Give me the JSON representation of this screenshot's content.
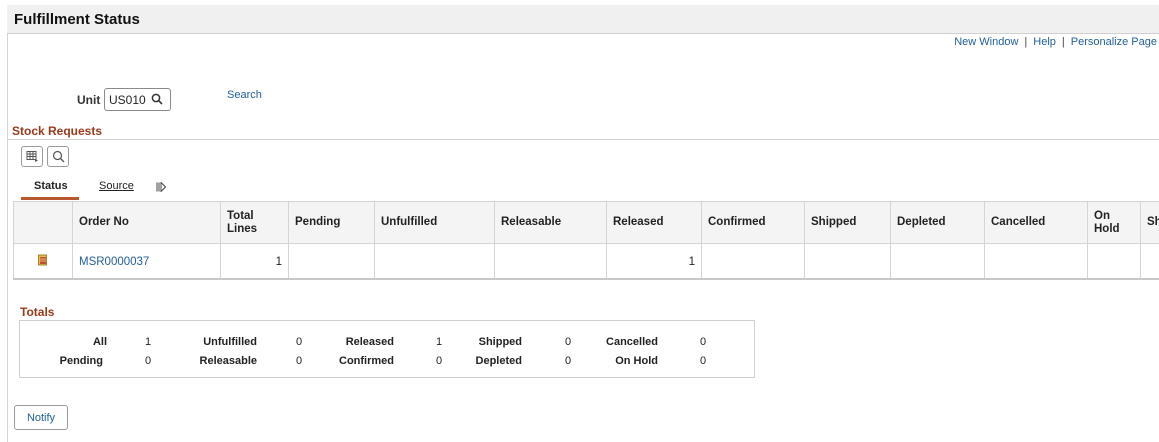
{
  "page": {
    "title": "Fulfillment Status"
  },
  "toplinks": {
    "new_window": "New Window",
    "help": "Help",
    "personalize": "Personalize Page",
    "separator": "|"
  },
  "search": {
    "unit_label": "Unit",
    "unit_value": "US010",
    "search_link": "Search"
  },
  "stock_requests": {
    "title": "Stock Requests",
    "tabs": [
      {
        "label": "Status"
      },
      {
        "label": "Source"
      }
    ],
    "columns": [
      "Order No",
      "Total Lines",
      "Pending",
      "Unfulfilled",
      "Releasable",
      "Released",
      "Confirmed",
      "Shipped",
      "Depleted",
      "Cancelled",
      "On Hold",
      "Sh"
    ],
    "rows": [
      {
        "order_no": "MSR0000037",
        "total_lines": "1",
        "pending": "",
        "unfulfilled": "",
        "releasable": "",
        "released": "1",
        "confirmed": "",
        "shipped": "",
        "depleted": "",
        "cancelled": "",
        "on_hold": ""
      }
    ]
  },
  "totals": {
    "title": "Totals",
    "row1": [
      {
        "label": "All",
        "value": "1"
      },
      {
        "label": "Unfulfilled",
        "value": "0"
      },
      {
        "label": "Released",
        "value": "1"
      },
      {
        "label": "Shipped",
        "value": "0"
      },
      {
        "label": "Cancelled",
        "value": "0"
      }
    ],
    "row2": [
      {
        "label": "Pending",
        "value": "0"
      },
      {
        "label": "Releasable",
        "value": "0"
      },
      {
        "label": "Confirmed",
        "value": "0"
      },
      {
        "label": "Depleted",
        "value": "0"
      },
      {
        "label": "On Hold",
        "value": "0"
      }
    ]
  },
  "buttons": {
    "notify": "Notify"
  },
  "colors": {
    "link": "#1f5f9a",
    "section_header": "#9a3a1a",
    "tab_accent": "#b8572b"
  },
  "icons": {
    "unit_lookup": "search-icon",
    "grid_personalize": "grid-icon",
    "grid_find": "search-icon",
    "show_all_columns": "expand-columns-icon",
    "row_detail": "document-icon"
  }
}
